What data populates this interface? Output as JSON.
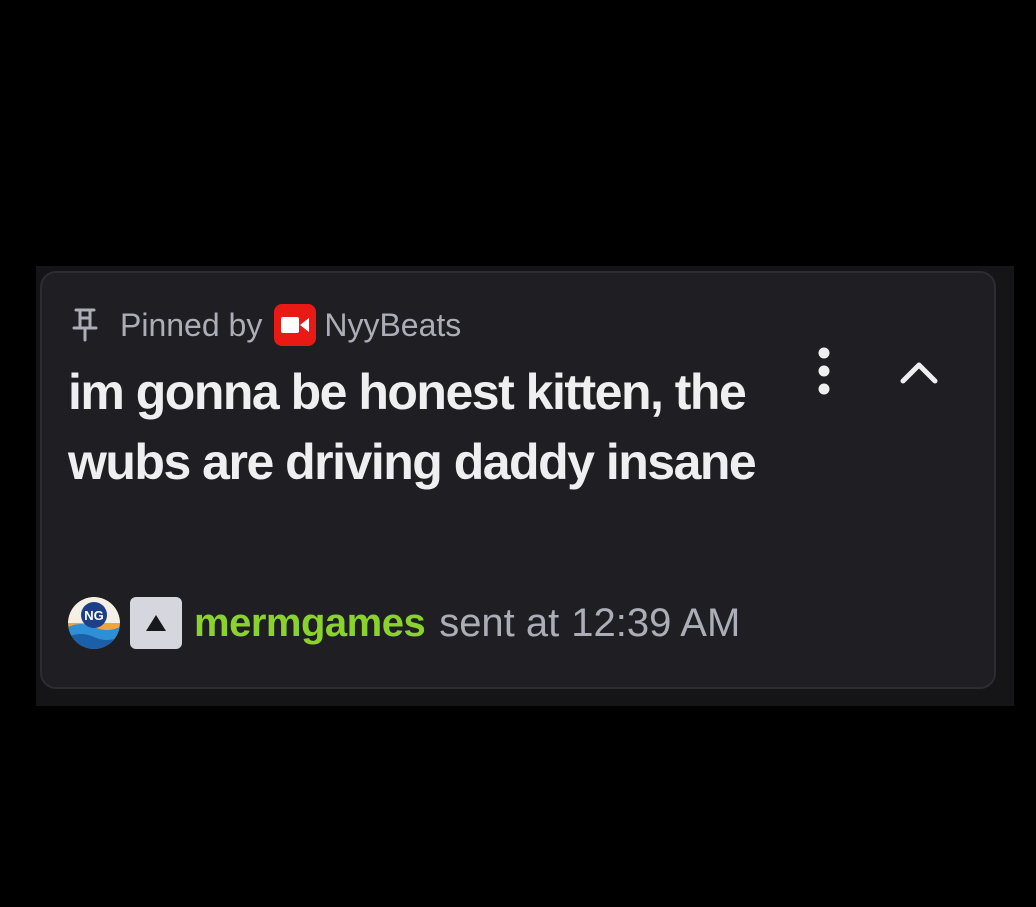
{
  "pinned": {
    "label": "Pinned by",
    "pinner": "NyyBeats",
    "pin_icon": "pin-icon",
    "pinner_badge_icon": "broadcaster-badge-icon"
  },
  "message": {
    "text": "im gonna be honest kitten, the wubs are driving daddy insane"
  },
  "sender": {
    "username": "mermgames",
    "sent_label": "sent at",
    "timestamp": "12:39 AM",
    "avatar_text": "NG",
    "username_color": "#8bd32c"
  },
  "actions": {
    "more_icon": "more-options-icon",
    "collapse_icon": "chevron-up-icon"
  },
  "colors": {
    "card_background": "#1f1f23",
    "broadcaster_badge": "#e91916",
    "text_primary": "#efeff1",
    "text_secondary": "#adadb8"
  }
}
